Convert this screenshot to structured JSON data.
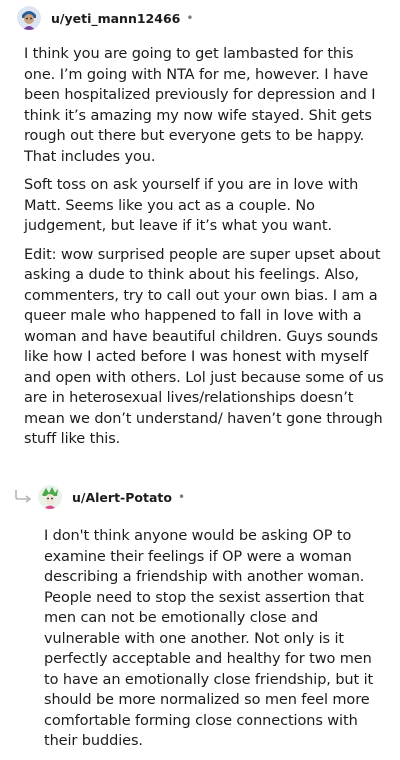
{
  "comments": [
    {
      "username": "u/yeti_mann12466",
      "separator": "•",
      "paragraphs": [
        "I think you are going to get lambasted for this one. I’m going with NTA for me, however. I have been hospitalized previously for depression and I think it’s amazing my now wife stayed. Shit gets rough out there but everyone gets to be happy. That includes you.",
        "Soft toss on ask yourself if you are in love with Matt. Seems like you act as a couple. No judgement, but leave if it’s what you want.",
        "Edit: wow surprised people are super upset about asking a dude to think about his feelings. Also, commenters, try to call out your own bias. I am a queer male who happened to fall in love with a woman and have beautiful children. Guys sounds like how I acted before I was honest with myself and open with others. Lol just because some of us are in heterosexual lives/relationships doesn’t mean we don’t understand/ haven’t gone through stuff like this."
      ]
    },
    {
      "username": "u/Alert-Potato",
      "separator": "•",
      "paragraphs": [
        "I don't think anyone would be asking OP to examine their feelings if OP were a woman describing a friendship with another woman. People need to stop the sexist assertion that men can not be emotionally close and vulnerable with one another. Not only is it perfectly acceptable and healthy for two men to have an emotionally close friendship, but it should be more normalized so men feel more comfortable forming close connections with their buddies."
      ]
    }
  ]
}
